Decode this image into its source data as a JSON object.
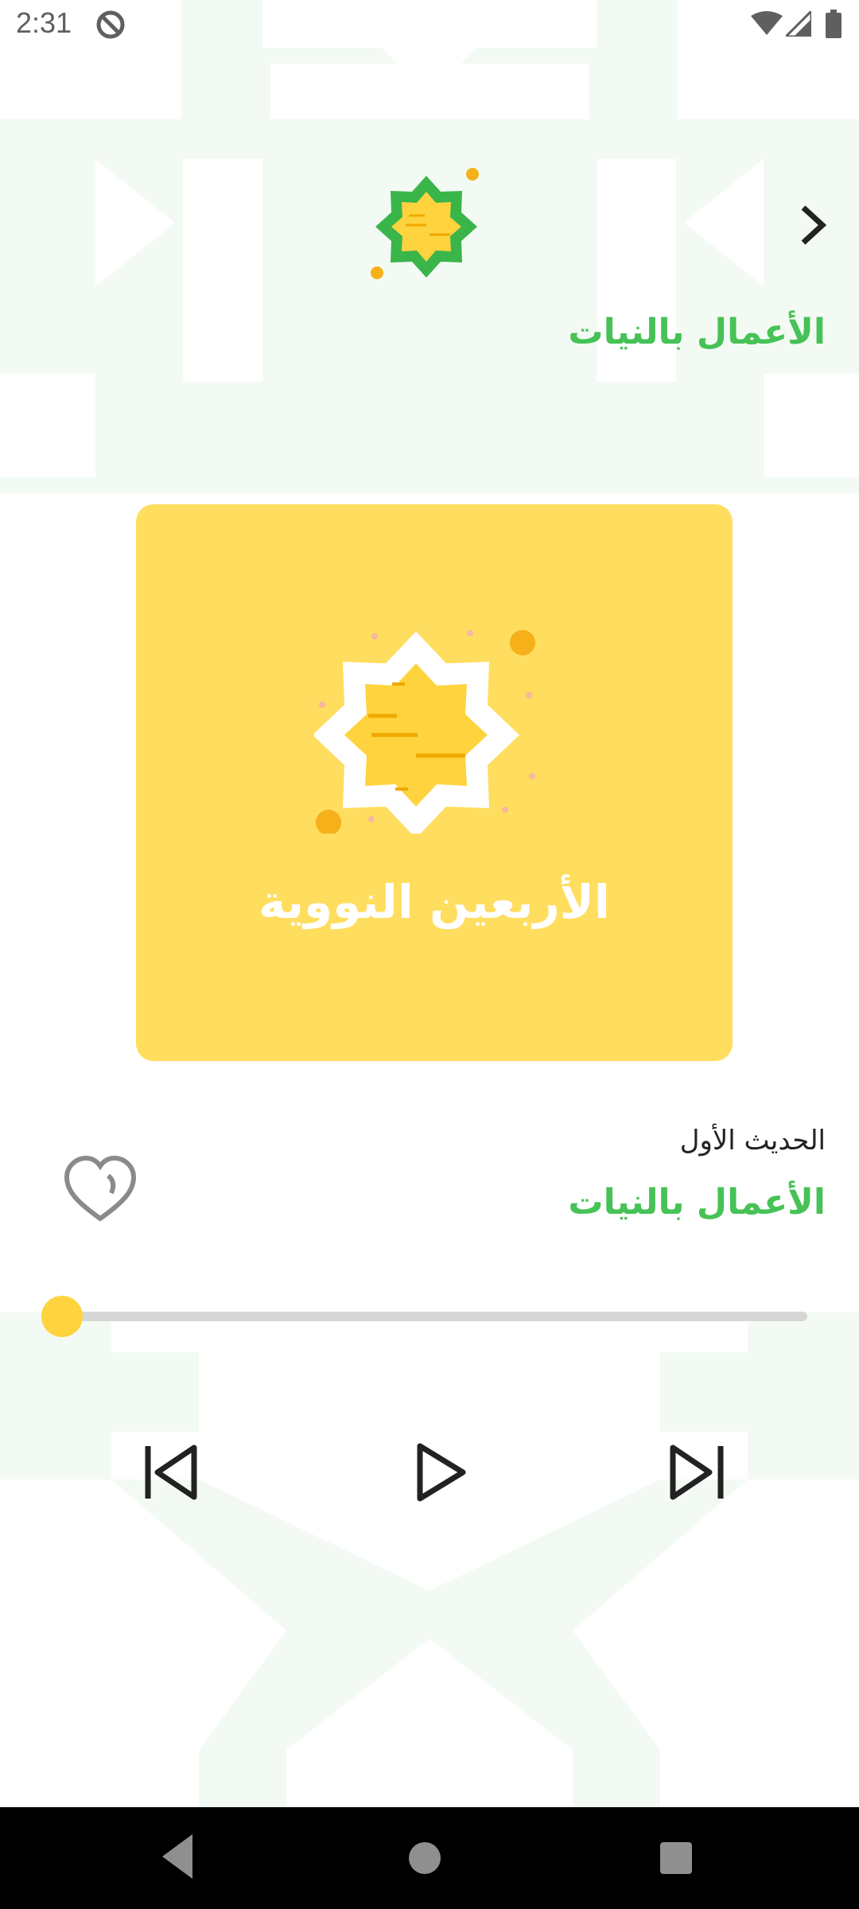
{
  "status_bar": {
    "time": "2:31",
    "icons": [
      "do-not-disturb-icon",
      "wifi-icon",
      "cellular-signal-icon",
      "battery-icon"
    ]
  },
  "header": {
    "title": "الأعمال بالنيات",
    "next_icon": "chevron-right-icon"
  },
  "cover": {
    "title": "الأربعين النووية",
    "icon": "eight-point-star-scroll-icon"
  },
  "track": {
    "number_label": "الحديث الأول",
    "title": "الأعمال بالنيات"
  },
  "playback": {
    "progress": 0.0,
    "controls": [
      "skip-previous-icon",
      "play-icon",
      "skip-next-icon"
    ]
  },
  "nav_bar": {
    "icons": [
      "back-triangle-icon",
      "home-circle-icon",
      "recents-square-icon"
    ]
  },
  "colors": {
    "accent_green": "#46c256",
    "cover_yellow": "#ffdd5f",
    "seek_yellow": "#ffd33d",
    "dark_green": "#3ab54a"
  }
}
